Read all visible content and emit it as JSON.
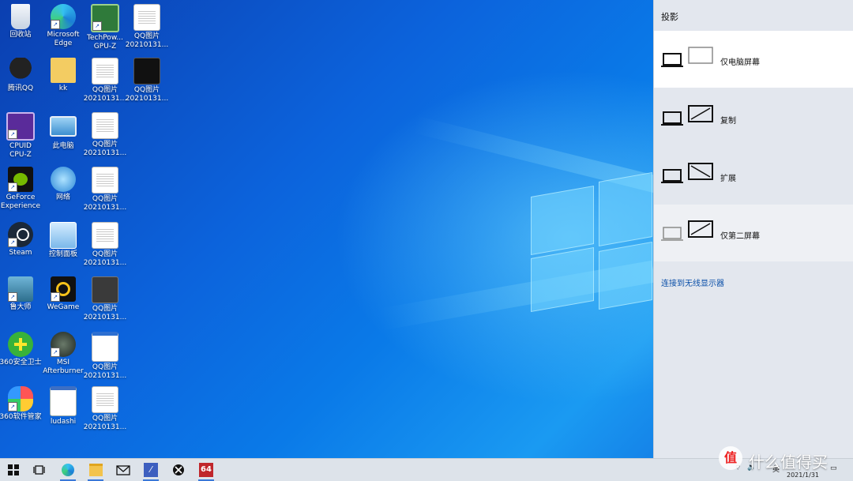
{
  "desktop": {
    "icons": [
      {
        "label": "回收站"
      },
      {
        "label": "Microsoft\nEdge"
      },
      {
        "label": "TechPow...\nGPU-Z"
      },
      {
        "label": "QQ图片\n20210131..."
      },
      {
        "label": "腾讯QQ"
      },
      {
        "label": "kk"
      },
      {
        "label": "QQ图片\n20210131..."
      },
      {
        "label": "QQ图片\n20210131..."
      },
      {
        "label": "CPUID\nCPU-Z"
      },
      {
        "label": "此电脑"
      },
      {
        "label": "QQ图片\n20210131..."
      },
      {
        "label": "GeForce\nExperience"
      },
      {
        "label": "网络"
      },
      {
        "label": "QQ图片\n20210131..."
      },
      {
        "label": "Steam"
      },
      {
        "label": "控制面板"
      },
      {
        "label": "QQ图片\n20210131..."
      },
      {
        "label": "鲁大师"
      },
      {
        "label": "WeGame"
      },
      {
        "label": "QQ图片\n20210131..."
      },
      {
        "label": "360安全卫士"
      },
      {
        "label": "MSI\nAfterburner"
      },
      {
        "label": "QQ图片\n20210131..."
      },
      {
        "label": "360软件管家"
      },
      {
        "label": "ludashi"
      },
      {
        "label": "QQ图片\n20210131..."
      }
    ]
  },
  "project_panel": {
    "title": "投影",
    "options": [
      {
        "label": "仅电脑屏幕",
        "selected": true
      },
      {
        "label": "复制",
        "selected": false
      },
      {
        "label": "扩展",
        "selected": false
      },
      {
        "label": "仅第二屏幕",
        "selected": false
      }
    ],
    "wireless_link": "连接到无线显示器"
  },
  "taskbar": {
    "tray_lang": "英",
    "date": "2021/1/31",
    "app_badge": "64"
  },
  "watermark": {
    "text": "什么值得买",
    "glyph": "值"
  },
  "colors": {
    "accent": "#3a78d8",
    "panel_bg": "#e3e7ee",
    "selected_bg": "#ffffff",
    "hover_bg": "#eef0f4"
  }
}
